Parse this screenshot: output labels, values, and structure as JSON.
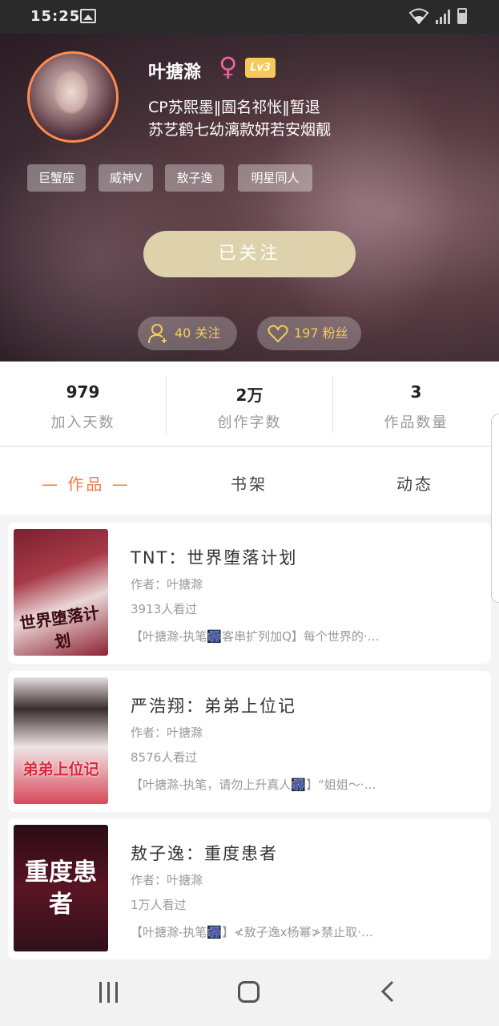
{
  "status_bar": {
    "time": "15:25"
  },
  "profile": {
    "name": "叶搪滁",
    "level": "Lv3",
    "bio_line1": "CP苏熙墨‖圄名祁怅‖暂退",
    "bio_line2": "苏艺鹤七幼漓款妍若安烟靓",
    "tags": [
      "巨蟹座",
      "威神V",
      "敖子逸",
      "明星同人"
    ],
    "follow_button": "已关注",
    "following": "40 关注",
    "fans": "197 粉丝"
  },
  "stats": [
    {
      "value": "979",
      "label": "加入天数"
    },
    {
      "value": "2万",
      "label": "创作字数"
    },
    {
      "value": "3",
      "label": "作品数量"
    }
  ],
  "tabs": [
    "— 作品 —",
    "书架",
    "动态"
  ],
  "books": [
    {
      "title": "TNT：世界堕落计划",
      "author": "作者：叶搪滁",
      "views": "3913人看过",
      "desc": "【叶搪滁-执笔🎆客串扩列加Q】每个世界的·…"
    },
    {
      "title": "严浩翔：弟弟上位记",
      "author": "作者：叶搪滁",
      "views": "8576人看过",
      "desc": "【叶搪滁-执笔，请勿上升真人🎆】“姐姐～·…"
    },
    {
      "title": "敖子逸：重度患者",
      "author": "作者：叶搪滁",
      "views": "1万人看过",
      "desc": "【叶搪滁-执笔🎆】≮敖子逸x杨幂≯禁止取·…"
    }
  ],
  "cover_text": [
    "世界堕落计划",
    "弟弟上位记",
    "重度患者"
  ]
}
